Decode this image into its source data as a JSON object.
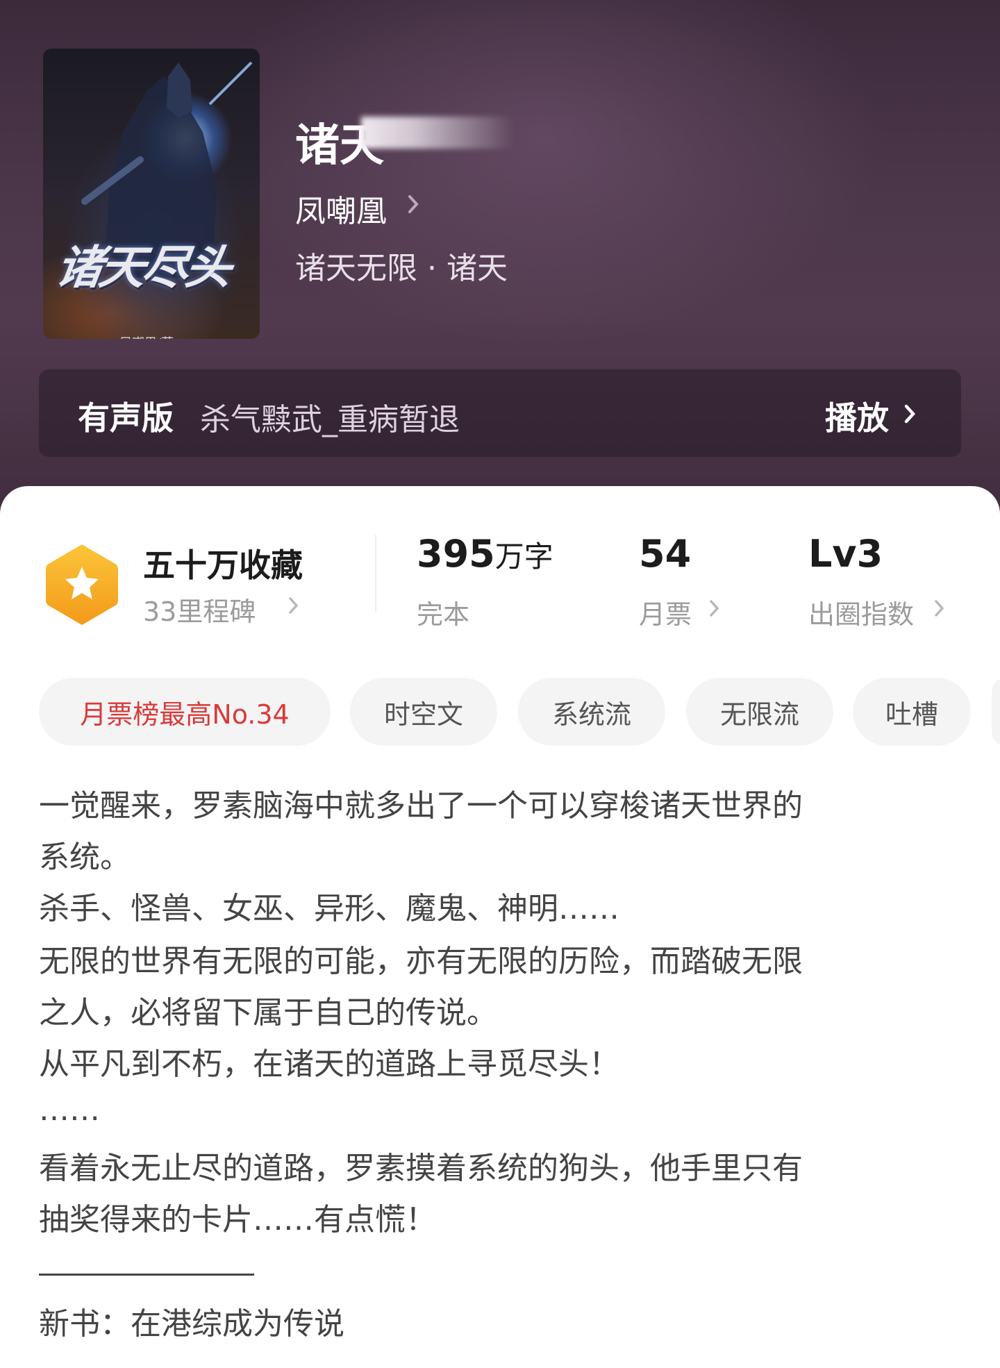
{
  "book": {
    "cover_title": "诸天尽头",
    "cover_author": "凤嘲凰/著",
    "title": "诸天",
    "author": "凤嘲凰",
    "genre": "诸天无限 · 诸天"
  },
  "audio": {
    "label": "有声版",
    "narrator": "杀气黩武_重病暂退",
    "play_label": "播放"
  },
  "stats": {
    "collect_title": "五十万收藏",
    "collect_sub": "33里程碑",
    "words_value": "395",
    "words_unit": "万字",
    "words_label": "完本",
    "tickets_value": "54",
    "tickets_label": "月票",
    "circle_value": "Lv3",
    "circle_label": "出圈指数"
  },
  "tags": [
    "月票榜最高No.34",
    "时空文",
    "系统流",
    "无限流",
    "吐槽"
  ],
  "description": [
    "一觉醒来，罗素脑海中就多出了一个可以穿梭诸天世界的",
    "系统。",
    "杀手、怪兽、女巫、异形、魔鬼、神明……",
    "无限的世界有无限的可能，亦有无限的历险，而踏破无限",
    "之人，必将留下属于自己的传说。",
    "从平凡到不朽，在诸天的道路上寻觅尽头！",
    "……",
    "看着永无止尽的道路，罗素摸着系统的狗头，他手里只有",
    "抽奖得来的卡片……有点慌！"
  ],
  "new_book": "新书：在港综成为传说",
  "colors": {
    "header_bg": "#4b3649",
    "hot_tag": "#d93a3a",
    "badge": "#f6b21e"
  }
}
